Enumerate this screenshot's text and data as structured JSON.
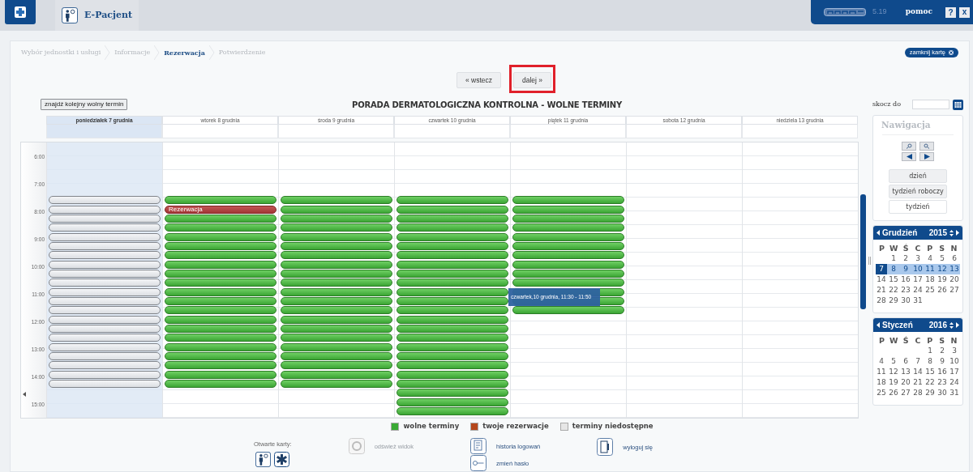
{
  "header": {
    "app_title": "E-Pacjent",
    "version": "5.19",
    "help_link": "pomoc",
    "help_button": "?",
    "close_button": "x"
  },
  "breadcrumbs": [
    {
      "label": "Wybór jednostki i usługi",
      "selected": false
    },
    {
      "label": "Informacje",
      "selected": false
    },
    {
      "label": "Rezerwacja",
      "selected": true
    },
    {
      "label": "Potwierdzenie",
      "selected": false
    }
  ],
  "close_tab_button": "zamknij kartę",
  "nav_buttons": [
    {
      "label": "« wstecz",
      "annotated": false
    },
    {
      "label": "dalej »",
      "annotated": true
    }
  ],
  "find_button": "znajdź kolejny wolny termin",
  "calendar_title": "PORADA DERMATOLOGICZNA KONTROLNA - WOLNE TERMINY",
  "hours": [
    "6:00",
    "7:00",
    "8:00",
    "9:00",
    "10:00",
    "11:00",
    "12:00",
    "13:00",
    "14:00",
    "15:00"
  ],
  "days": [
    {
      "label": "poniedziałek 7 grudnia",
      "selected": true,
      "slots": [
        {
          "kind": "unavailable"
        },
        {
          "kind": "unavailable"
        },
        {
          "kind": "unavailable"
        },
        {
          "kind": "unavailable"
        },
        {
          "kind": "unavailable"
        },
        {
          "kind": "unavailable"
        },
        {
          "kind": "unavailable"
        },
        {
          "kind": "unavailable"
        },
        {
          "kind": "unavailable"
        },
        {
          "kind": "unavailable"
        },
        {
          "kind": "unavailable"
        },
        {
          "kind": "unavailable"
        },
        {
          "kind": "unavailable"
        },
        {
          "kind": "unavailable"
        },
        {
          "kind": "unavailable"
        },
        {
          "kind": "unavailable"
        },
        {
          "kind": "unavailable"
        },
        {
          "kind": "unavailable"
        },
        {
          "kind": "unavailable"
        },
        {
          "kind": "unavailable"
        },
        {
          "kind": "unavailable"
        }
      ]
    },
    {
      "label": "wtorek 8 grudnia",
      "selected": false,
      "slots": [
        {
          "kind": "free"
        },
        {
          "kind": "reserved",
          "label": "Rezerwacja"
        },
        {
          "kind": "free"
        },
        {
          "kind": "free"
        },
        {
          "kind": "free"
        },
        {
          "kind": "free"
        },
        {
          "kind": "free"
        },
        {
          "kind": "free"
        },
        {
          "kind": "free"
        },
        {
          "kind": "free"
        },
        {
          "kind": "free"
        },
        {
          "kind": "free"
        },
        {
          "kind": "free"
        },
        {
          "kind": "free"
        },
        {
          "kind": "free"
        },
        {
          "kind": "free"
        },
        {
          "kind": "free"
        },
        {
          "kind": "free"
        },
        {
          "kind": "free"
        },
        {
          "kind": "free"
        },
        {
          "kind": "free"
        }
      ]
    },
    {
      "label": "środa 9 grudnia",
      "selected": false,
      "slots": [
        {
          "kind": "free"
        },
        {
          "kind": "free"
        },
        {
          "kind": "free"
        },
        {
          "kind": "free"
        },
        {
          "kind": "free"
        },
        {
          "kind": "free"
        },
        {
          "kind": "free"
        },
        {
          "kind": "free"
        },
        {
          "kind": "free"
        },
        {
          "kind": "free"
        },
        {
          "kind": "free"
        },
        {
          "kind": "free"
        },
        {
          "kind": "free"
        },
        {
          "kind": "free"
        },
        {
          "kind": "free"
        },
        {
          "kind": "free"
        },
        {
          "kind": "free"
        },
        {
          "kind": "free"
        },
        {
          "kind": "free"
        },
        {
          "kind": "free"
        },
        {
          "kind": "free"
        }
      ]
    },
    {
      "label": "czwartek 10 grudnia",
      "selected": false,
      "slots": [
        {
          "kind": "free"
        },
        {
          "kind": "free"
        },
        {
          "kind": "free"
        },
        {
          "kind": "free"
        },
        {
          "kind": "free"
        },
        {
          "kind": "free"
        },
        {
          "kind": "free"
        },
        {
          "kind": "free"
        },
        {
          "kind": "free"
        },
        {
          "kind": "free"
        },
        {
          "kind": "free"
        },
        {
          "kind": "free"
        },
        {
          "kind": "free"
        },
        {
          "kind": "free"
        },
        {
          "kind": "free"
        },
        {
          "kind": "free"
        },
        {
          "kind": "free"
        },
        {
          "kind": "free"
        },
        {
          "kind": "free"
        },
        {
          "kind": "free"
        },
        {
          "kind": "free"
        },
        {
          "kind": "free"
        },
        {
          "kind": "free"
        },
        {
          "kind": "free"
        }
      ]
    },
    {
      "label": "piątek 11 grudnia",
      "selected": false,
      "slots": [
        {
          "kind": "free"
        },
        {
          "kind": "free"
        },
        {
          "kind": "free"
        },
        {
          "kind": "free"
        },
        {
          "kind": "free"
        },
        {
          "kind": "free"
        },
        {
          "kind": "free"
        },
        {
          "kind": "free"
        },
        {
          "kind": "free"
        },
        {
          "kind": "free"
        },
        {
          "kind": "free"
        },
        {
          "kind": "free"
        },
        {
          "kind": "free"
        }
      ]
    },
    {
      "label": "sobota 12 grudnia",
      "selected": false
    },
    {
      "label": "niedziela 13 grudnia",
      "selected": false
    }
  ],
  "tooltip": "czwartek,10 grudnia, 11:30 - 11:50",
  "jump": {
    "label": "skocz do"
  },
  "navigation": {
    "title": "Nawigacja",
    "views": [
      {
        "label": "dzień",
        "selected": false
      },
      {
        "label": "tydzień roboczy",
        "selected": false
      },
      {
        "label": "tydzień",
        "selected": true
      }
    ]
  },
  "months": [
    {
      "name": "Grudzień",
      "year": "2015",
      "weekdays": [
        "P",
        "W",
        "Ś",
        "C",
        "P",
        "S",
        "N"
      ],
      "weeks": [
        {
          "days": [
            "1",
            "2",
            "3",
            "4",
            "5",
            "6"
          ],
          "highlighted": false,
          "first_day_selected": false
        },
        {
          "days": [
            "7",
            "8",
            "9",
            "10",
            "11",
            "12",
            "13"
          ],
          "highlighted": true,
          "first_day_selected": true
        },
        {
          "days": [
            "14",
            "15",
            "16",
            "17",
            "18",
            "19",
            "20"
          ],
          "highlighted": false,
          "first_day_selected": false
        },
        {
          "days": [
            "21",
            "22",
            "23",
            "24",
            "25",
            "26",
            "27"
          ],
          "highlighted": false,
          "first_day_selected": false
        },
        {
          "days": [
            "28",
            "29",
            "30",
            "31"
          ],
          "highlighted": false,
          "first_day_selected": false
        }
      ]
    },
    {
      "name": "Styczeń",
      "year": "2016",
      "weekdays": [
        "P",
        "W",
        "Ś",
        "C",
        "P",
        "S",
        "N"
      ],
      "weeks": [
        {
          "days": [
            "1",
            "2",
            "3"
          ],
          "highlighted": false,
          "first_day_selected": false
        },
        {
          "days": [
            "4",
            "5",
            "6",
            "7",
            "8",
            "9",
            "10"
          ],
          "highlighted": false,
          "first_day_selected": false
        },
        {
          "days": [
            "11",
            "12",
            "13",
            "14",
            "15",
            "16",
            "17"
          ],
          "highlighted": false,
          "first_day_selected": false
        },
        {
          "days": [
            "18",
            "19",
            "20",
            "21",
            "22",
            "23",
            "24"
          ],
          "highlighted": false,
          "first_day_selected": false
        },
        {
          "days": [
            "25",
            "26",
            "27",
            "28",
            "29",
            "30",
            "31"
          ],
          "highlighted": false,
          "first_day_selected": false
        }
      ]
    }
  ],
  "legend": [
    {
      "label": "wolne terminy",
      "color": "#3aaa35"
    },
    {
      "label": "twoje rezerwacje",
      "color": "#b5471c"
    },
    {
      "label": "terminy niedostępne",
      "color": "#e6e6e6"
    }
  ],
  "footer": {
    "open_tabs_label": "Otwarte karty:",
    "actions": [
      {
        "label": "odśwież widok",
        "disabled": true,
        "kind": "refresh"
      },
      {
        "label": "historia logowań",
        "disabled": false,
        "kind": "history"
      },
      {
        "label": "zmień hasło",
        "disabled": false,
        "kind": "password"
      },
      {
        "label": "wyloguj się",
        "disabled": false,
        "kind": "logout"
      }
    ]
  }
}
